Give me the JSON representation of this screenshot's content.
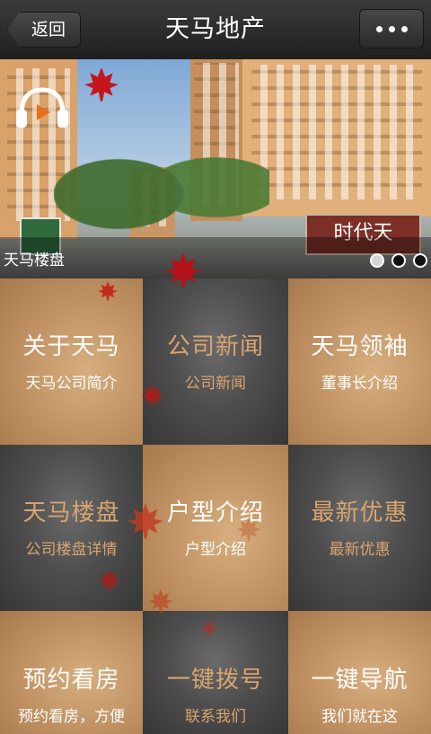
{
  "header": {
    "back_label": "返回",
    "title": "天马地产",
    "more_icon": "more-dots-icon"
  },
  "banner": {
    "caption": "天马楼盘",
    "sign_text": "时代天",
    "slides": {
      "total": 3,
      "active": 1
    },
    "audio_icon": "headphone-play-icon"
  },
  "menu": [
    {
      "title": "关于天马",
      "subtitle": "天马公司简介",
      "style": "gold"
    },
    {
      "title": "公司新闻",
      "subtitle": "公司新闻",
      "style": "dark"
    },
    {
      "title": "天马领袖",
      "subtitle": "董事长介绍",
      "style": "gold"
    },
    {
      "title": "天马楼盘",
      "subtitle": "公司楼盘详情",
      "style": "dark"
    },
    {
      "title": "户型介绍",
      "subtitle": "户型介绍",
      "style": "gold"
    },
    {
      "title": "最新优惠",
      "subtitle": "最新优惠",
      "style": "dark"
    },
    {
      "title": "预约看房",
      "subtitle": "预约看房，方便",
      "style": "gold"
    },
    {
      "title": "一键拨号",
      "subtitle": "联系我们",
      "style": "dark"
    },
    {
      "title": "一键导航",
      "subtitle": "我们就在这",
      "style": "gold"
    }
  ],
  "colors": {
    "gold": "#c49667",
    "dark": "#4e4e4e",
    "accent_text": "#d9a46e",
    "leaf": "#c4161c"
  }
}
